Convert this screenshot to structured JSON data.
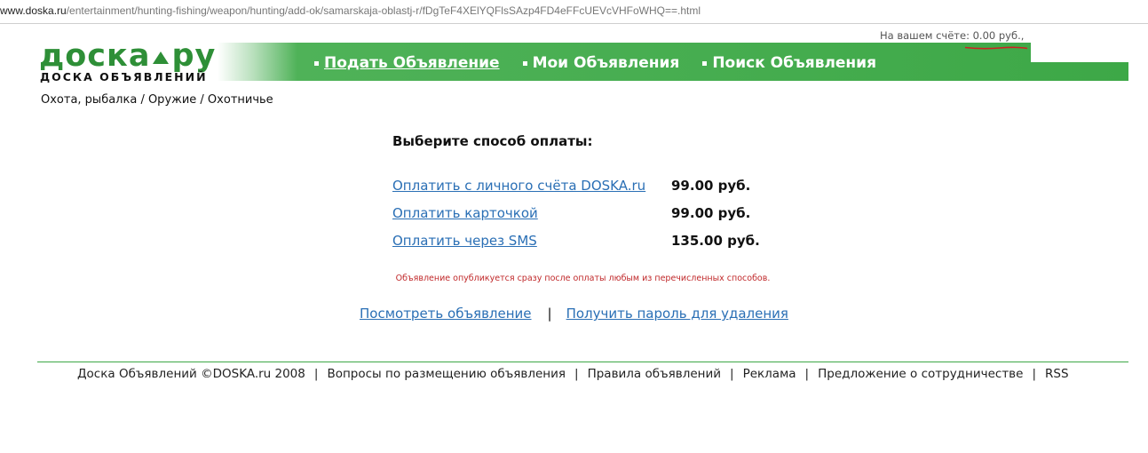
{
  "url": {
    "host": "www.doska.ru",
    "path": "/entertainment/hunting-fishing/weapon/hunting/add-ok/samarskaja-oblastj-r/fDgTeF4XElYQFlsSAzp4FD4eFFcUEVcVHFoWHQ==.html"
  },
  "header": {
    "balance_label": "На вашем счёте:",
    "balance_value": "0.00 руб.,",
    "annotation_color": "#cc2222",
    "logo_left": "доска",
    "logo_right": "ру",
    "logo_sub": "ДОСКА ОБЪЯВЛЕНИЙ",
    "brand_color": "#3da847"
  },
  "nav": {
    "items": [
      {
        "label": "Подать Объявление",
        "active": true
      },
      {
        "label": "Мои Объявления",
        "active": false
      },
      {
        "label": "Поиск Объявления",
        "active": false
      }
    ]
  },
  "breadcrumb": "Охота, рыбалка / Оружие / Охотничье",
  "payment": {
    "title": "Выберите способ оплаты:",
    "options": [
      {
        "label": "Оплатить с личного счёта DOSKA.ru",
        "price": "99.00 руб."
      },
      {
        "label": "Оплатить карточкой",
        "price": "99.00 руб."
      },
      {
        "label": "Оплатить через SMS",
        "price": "135.00 руб."
      }
    ],
    "notice": "Объявление опубликуется сразу после оплаты любым из перечисленных способов."
  },
  "actions": {
    "view_label": "Посмотреть объявление",
    "separator": "|",
    "password_label": "Получить пароль для удаления"
  },
  "footer": {
    "copyright": "Доска Объявлений ©DOSKA.ru 2008",
    "links": [
      "Вопросы по размещению объявления",
      "Правила объявлений",
      "Реклама",
      "Предложение о сотрудничестве",
      "RSS"
    ],
    "separator": "|"
  }
}
